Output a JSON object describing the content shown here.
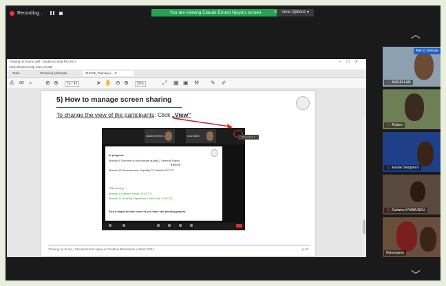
{
  "topbar": {
    "recording_label": "Recording...",
    "viewing_text": "You are viewing Claude Ernest Njoya's screen",
    "view_options_label": "View Options"
  },
  "acrobat": {
    "title": "Training on Zoom2.pdf - Adobe Acrobat Pro 2017",
    "menu": "View   Window   Help   Cisco-Portal",
    "tabs": [
      "Tools",
      "Technical_Informati...",
      "210315_Training o..."
    ],
    "page_box": "16 / 42",
    "zoom_box": "55%"
  },
  "slide": {
    "title": "5) How to manage screen sharing",
    "subtitle_prefix": "To change the view of the participants",
    "subtitle_mid": ": Click ",
    "subtitle_action": "„View\"",
    "footer_left": "Training on Zoom  |  Claude Ernest Njoya & Christine Berenheim  |  March 2021",
    "footer_page": "p.16",
    "inner": {
      "tile1": "Claude Ernest N...",
      "tile2": "Lina Kathm",
      "view_btn": "View options ▾",
      "lines": [
        "In progress",
        "Module 6      Theories of educational quality 2 Seminar Paper",
        "5 ECTS",
        "Module 10     Development of quality 2 Portfolio 5 ECTS",
        "Still pending",
        "Module 10   Master Thesis 15 ECTS",
        "Module 11   Working Experience Oral Exam 10 ECTS",
        "And it might be that some of you have still pending papers."
      ]
    }
  },
  "gallery": {
    "ask_label": "Ask to Unmute",
    "participants": [
      "MAGELLAN",
      "Rulavo",
      "Essaw Sangana's",
      "Darlaine KYAMUNDU",
      "Nyirarugero"
    ]
  },
  "colors": {
    "viewing_banner": "#23a455",
    "accent_blue": "#1d4ba8",
    "red": "#e22222"
  }
}
